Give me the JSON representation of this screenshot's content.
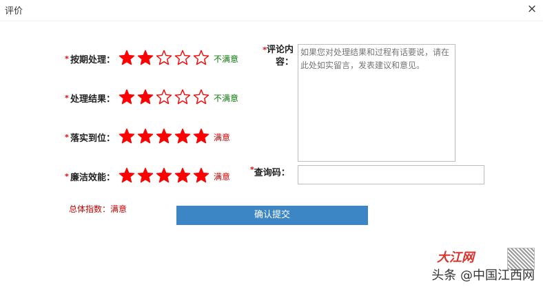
{
  "window": {
    "title": "评价",
    "close_icon": "×"
  },
  "ratings": [
    {
      "label": "按期处理：",
      "stars_filled": 2,
      "stars_total": 5,
      "text": "不满意",
      "text_color": "#0a7a0a"
    },
    {
      "label": "处理结果：",
      "stars_filled": 2,
      "stars_total": 5,
      "text": "不满意",
      "text_color": "#0a7a0a"
    },
    {
      "label": "落实到位：",
      "stars_filled": 5,
      "stars_total": 5,
      "text": "满意",
      "text_color": "#cc0000"
    },
    {
      "label": "廉洁效能：",
      "stars_filled": 5,
      "stars_total": 5,
      "text": "满意",
      "text_color": "#cc0000"
    }
  ],
  "required_mark": "*",
  "overall": {
    "text": "总体指数：满意"
  },
  "comment": {
    "label": "评论内容：",
    "placeholder": "如果您对处理结果和过程有话要说，请在此处如实留言，发表建议和意见。"
  },
  "query": {
    "label": "查询码：",
    "value": ""
  },
  "submit": {
    "label": "确认提交"
  },
  "watermark": {
    "logo": "大江网",
    "text": "头条 @中国江西网"
  },
  "colors": {
    "star": "#ff0000",
    "button": "#3d86c6"
  }
}
